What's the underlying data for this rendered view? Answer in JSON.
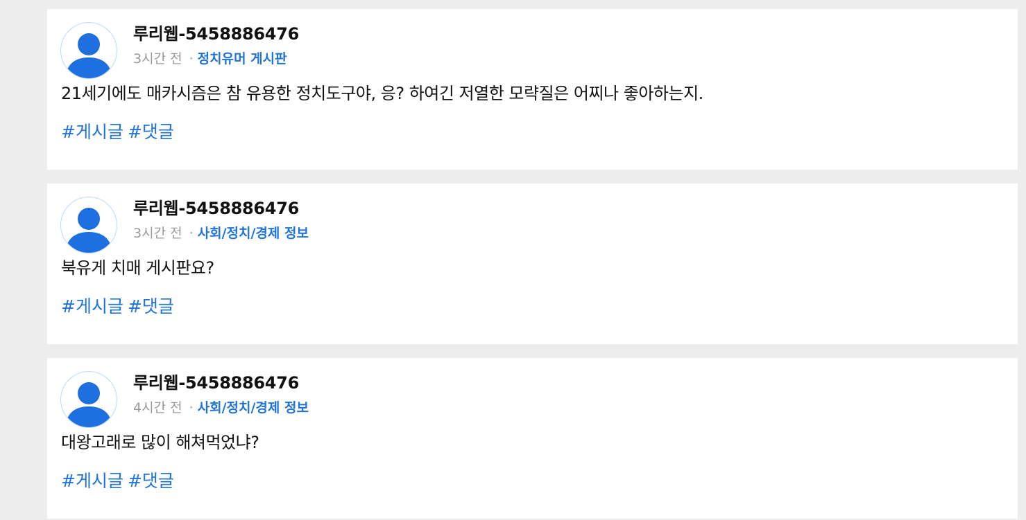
{
  "posts": [
    {
      "author": "루리웹-5458886476",
      "time": "3시간 전",
      "separator": "·",
      "board": "정치유머 게시판",
      "content": "21세기에도 매카시즘은 참 유용한 정치도구야, 응? 하여긴 저열한 모략질은 어찌나 좋아하는지.",
      "tags": [
        "#게시글",
        "#댓글"
      ],
      "avatar_icon": "user-avatar-icon"
    },
    {
      "author": "루리웹-5458886476",
      "time": "3시간 전",
      "separator": "·",
      "board": "사회/정치/경제 정보",
      "content": "북유게 치매 게시판요?",
      "tags": [
        "#게시글",
        "#댓글"
      ],
      "avatar_icon": "user-avatar-icon"
    },
    {
      "author": "루리웹-5458886476",
      "time": "4시간 전",
      "separator": "·",
      "board": "사회/정치/경제 정보",
      "content": "대왕고래로 많이 해쳐먹었냐?",
      "tags": [
        "#게시글",
        "#댓글"
      ],
      "avatar_icon": "user-avatar-icon"
    }
  ],
  "colors": {
    "background": "#ededed",
    "card": "#ffffff",
    "accent": "#1f73d9",
    "avatar": "#1e6fe0",
    "meta_text": "#9a9a9a"
  }
}
